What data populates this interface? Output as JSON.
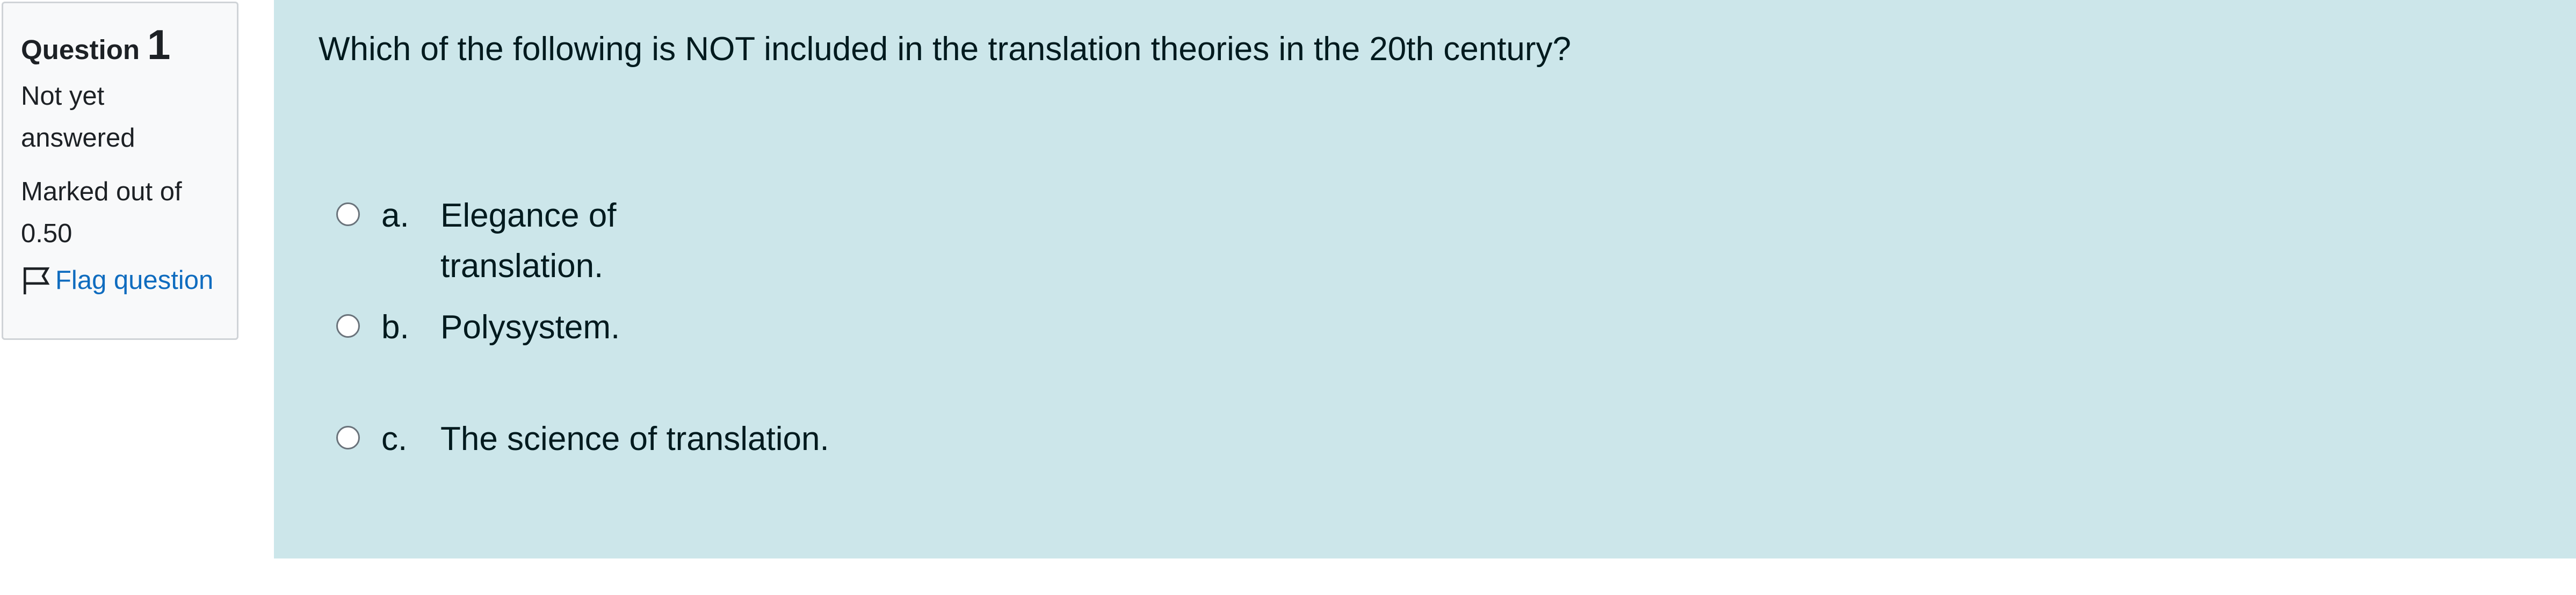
{
  "question": {
    "label": "Question",
    "number": "1",
    "state": "Not yet answered",
    "grade": "Marked out of 0.50",
    "flag_label": "Flag question",
    "text": "Which of the following is NOT included in the translation theories in the 20th century?"
  },
  "answers": [
    {
      "letter": "a.",
      "text": "Elegance of translation."
    },
    {
      "letter": "b.",
      "text": "Polysystem."
    },
    {
      "letter": "c.",
      "text": "The science of translation."
    }
  ],
  "colors": {
    "content_bg": "#cce6ea",
    "info_bg": "#f8f9fa",
    "link": "#0f6cbf"
  },
  "icons": {
    "flag": "flag-icon"
  }
}
